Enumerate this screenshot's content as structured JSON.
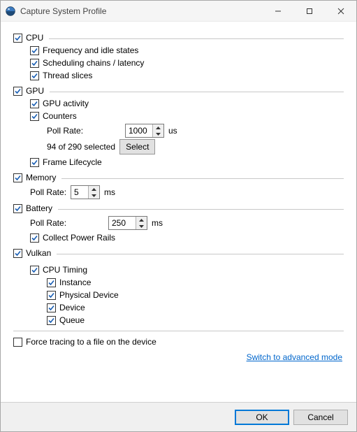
{
  "window": {
    "title": "Capture System Profile"
  },
  "cpu": {
    "label": "CPU",
    "freq": "Frequency and idle states",
    "sched": "Scheduling chains / latency",
    "slices": "Thread slices"
  },
  "gpu": {
    "label": "GPU",
    "activity": "GPU activity",
    "counters": "Counters",
    "pollrate_label": "Poll Rate:",
    "pollrate_value": "1000",
    "pollrate_unit": "us",
    "selected_text": "94 of 290 selected",
    "select_button": "Select",
    "frame_lifecycle": "Frame Lifecycle"
  },
  "memory": {
    "label": "Memory",
    "pollrate_label": "Poll Rate:",
    "pollrate_value": "5",
    "pollrate_unit": "ms"
  },
  "battery": {
    "label": "Battery",
    "pollrate_label": "Poll Rate:",
    "pollrate_value": "250",
    "pollrate_unit": "ms",
    "rails": "Collect Power Rails"
  },
  "vulkan": {
    "label": "Vulkan",
    "cpu_timing": "CPU Timing",
    "instance": "Instance",
    "physical_device": "Physical Device",
    "device": "Device",
    "queue": "Queue"
  },
  "force_tracing": "Force tracing to a file on the device",
  "advanced_link": "Switch to advanced mode",
  "buttons": {
    "ok": "OK",
    "cancel": "Cancel"
  }
}
